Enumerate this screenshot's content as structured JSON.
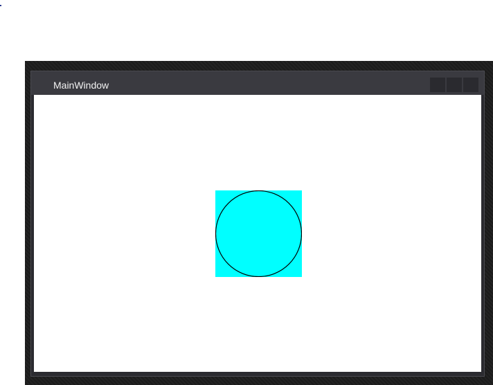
{
  "window": {
    "title": "MainWindow"
  },
  "canvas": {
    "square_color": "#00ffff",
    "circle_fill": "#00ffff",
    "circle_stroke": "#000000"
  },
  "icons": {
    "minimize": "minimize-icon",
    "maximize": "maximize-icon",
    "close": "close-icon"
  }
}
